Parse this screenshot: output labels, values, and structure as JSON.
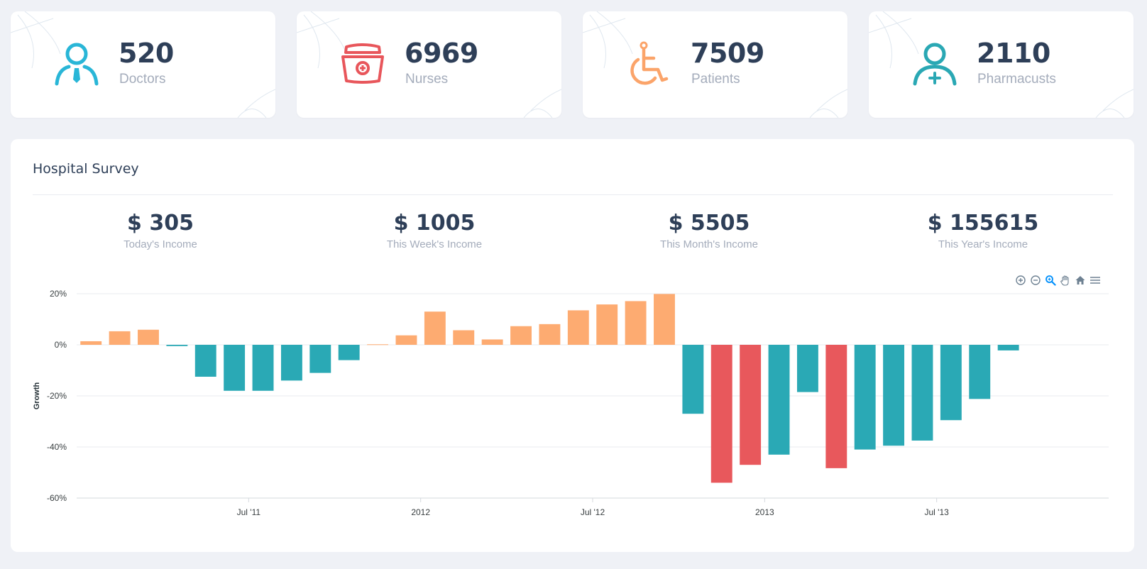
{
  "stats": [
    {
      "value": "520",
      "label": "Doctors",
      "icon": "doctor-icon",
      "color": "#29b6d7"
    },
    {
      "value": "6969",
      "label": "Nurses",
      "icon": "nurse-cap-icon",
      "color": "#e8565b"
    },
    {
      "value": "7509",
      "label": "Patients",
      "icon": "wheelchair-icon",
      "color": "#fba46a"
    },
    {
      "value": "2110",
      "label": "Pharmacusts",
      "icon": "pharmacist-icon",
      "color": "#2aa8b4"
    }
  ],
  "survey": {
    "title": "Hospital Survey",
    "incomes": [
      {
        "amount": "$ 305",
        "label": "Today's Income"
      },
      {
        "amount": "$ 1005",
        "label": "This Week's Income"
      },
      {
        "amount": "$ 5505",
        "label": "This Month's Income"
      },
      {
        "amount": "$ 155615",
        "label": "This Year's Income"
      }
    ]
  },
  "toolbar": [
    "zoom-in-icon",
    "zoom-out-icon",
    "selection-zoom-icon",
    "pan-hand-icon",
    "reset-home-icon",
    "menu-icon"
  ],
  "chart_data": {
    "type": "bar",
    "ylabel": "Growth",
    "ylim": [
      -60,
      20
    ],
    "yticks": [
      20,
      0,
      -20,
      -40,
      -60
    ],
    "ytick_labels": [
      "20%",
      "0%",
      "-20%",
      "-40%",
      "-60%"
    ],
    "x_start": "2011-01",
    "x_end": "2013-12",
    "xtick_labels": [
      {
        "label": "Jul '11",
        "date": "2011-07"
      },
      {
        "label": "2012",
        "date": "2012-01"
      },
      {
        "label": "Jul '12",
        "date": "2012-07"
      },
      {
        "label": "2013",
        "date": "2013-01"
      },
      {
        "label": "Jul '13",
        "date": "2013-07"
      }
    ],
    "colors": {
      "positive": "#fdab71",
      "negative": "#2aa9b5",
      "strong_negative": "#e8585c"
    },
    "x": [
      "2011-01",
      "2011-02",
      "2011-03",
      "2011-04",
      "2011-05",
      "2011-06",
      "2011-07",
      "2011-08",
      "2011-09",
      "2011-10",
      "2011-11",
      "2011-12",
      "2012-01",
      "2012-02",
      "2012-03",
      "2012-04",
      "2012-05",
      "2012-06",
      "2012-07",
      "2012-08",
      "2012-09",
      "2012-10",
      "2012-11",
      "2012-12",
      "2013-01",
      "2013-02",
      "2013-03",
      "2013-04",
      "2013-05",
      "2013-06",
      "2013-07",
      "2013-08",
      "2013-09"
    ],
    "values": [
      1.4,
      5.3,
      5.9,
      -0.5,
      -12.5,
      -18,
      -18,
      -14,
      -11,
      -6,
      0.2,
      3.7,
      13,
      5.7,
      2.1,
      7.3,
      8.1,
      13.5,
      15.8,
      17.1,
      19.9,
      -27,
      -54,
      -47,
      -43,
      -18.5,
      -48.3,
      -41,
      -39.5,
      -37.5,
      -29.5,
      -21.2,
      -2.2
    ],
    "bar_colors": [
      "positive",
      "positive",
      "positive",
      "negative",
      "negative",
      "negative",
      "negative",
      "negative",
      "negative",
      "negative",
      "positive",
      "positive",
      "positive",
      "positive",
      "positive",
      "positive",
      "positive",
      "positive",
      "positive",
      "positive",
      "positive",
      "negative",
      "strong_negative",
      "strong_negative",
      "negative",
      "negative",
      "strong_negative",
      "negative",
      "negative",
      "negative",
      "negative",
      "negative",
      "negative"
    ]
  }
}
